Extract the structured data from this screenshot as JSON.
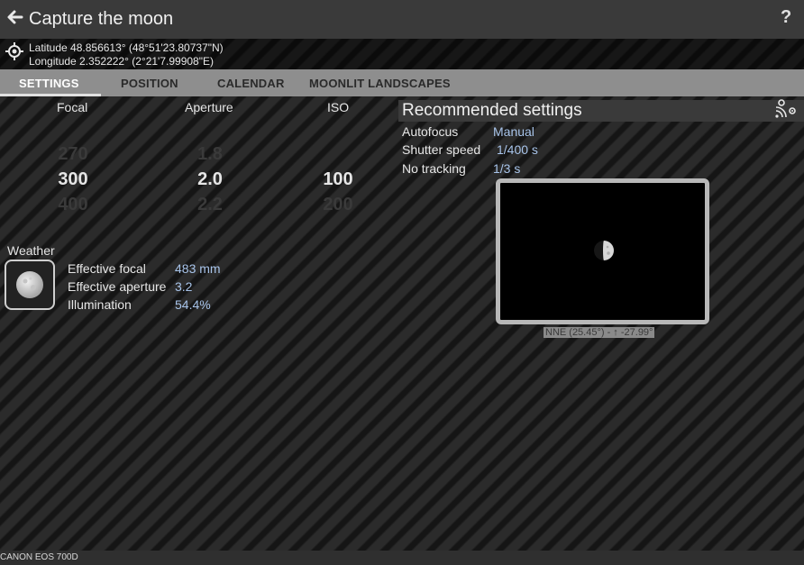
{
  "header": {
    "title": "Capture the moon",
    "help_label": "?"
  },
  "location": {
    "latitude": "Latitude 48.856613° (48°51'23.80737\"N)",
    "longitude": "Longitude 2.352222° (2°21'7.99908\"E)"
  },
  "tabs": [
    {
      "label": "SETTINGS",
      "active": true
    },
    {
      "label": "POSITION",
      "active": false
    },
    {
      "label": "CALENDAR",
      "active": false
    },
    {
      "label": "MOONLIT LANDSCAPES",
      "active": false
    }
  ],
  "pickers": {
    "focal": {
      "label": "Focal",
      "prev": "270",
      "current": "300",
      "next": "400"
    },
    "aperture": {
      "label": "Aperture",
      "prev": "1.8",
      "current": "2.0",
      "next": "2.2"
    },
    "iso": {
      "label": "ISO",
      "prev": "",
      "current": "100",
      "next": "200"
    }
  },
  "weather": {
    "label": "Weather"
  },
  "info": {
    "effective_focal_label": "Effective focal",
    "effective_focal_value": "483 mm",
    "effective_aperture_label": "Effective aperture",
    "effective_aperture_value": "3.2",
    "illumination_label": "Illumination",
    "illumination_value": "54.4%"
  },
  "recommended": {
    "title": "Recommended settings",
    "autofocus_label": "Autofocus",
    "autofocus_value": "Manual",
    "shutter_label": "Shutter speed",
    "shutter_value": "1/400 s",
    "tracking_label": "No tracking",
    "tracking_value": "1/3 s"
  },
  "preview": {
    "direction": "NNE (25.45°) - ↑ -27.99°"
  },
  "footer": {
    "camera": "CANON EOS 700D"
  },
  "colors": {
    "accent_value": "#a8c4ea",
    "tab_bar": "#8e8e8e",
    "top_bar": "#3a3a3a"
  },
  "icons": [
    "back-arrow-icon",
    "help-icon",
    "location-target-icon",
    "moon-icon",
    "share-settings-icon"
  ]
}
